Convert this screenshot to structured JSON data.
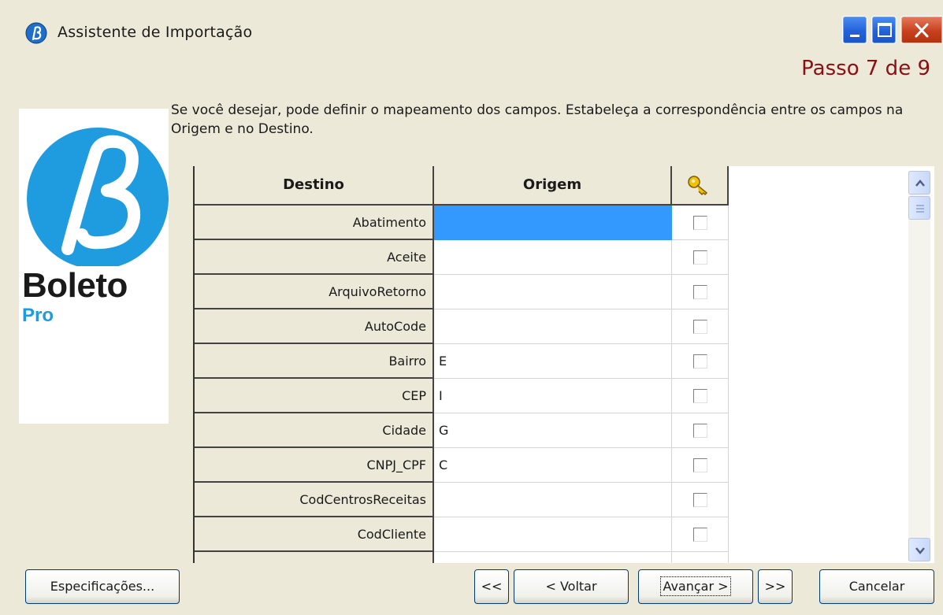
{
  "window": {
    "title": "Assistente de Importação",
    "step_label": "Passo 7 de 9",
    "description": "Se você desejar, pode definir o mapeamento dos campos. Estabeleça a correspondência entre os campos na Origem e no Destino."
  },
  "logo": {
    "word": "Boleto",
    "sub": "Pro",
    "accent_color": "#1f9ce0"
  },
  "grid": {
    "headers": {
      "destino": "Destino",
      "origem": "Origem",
      "key_icon": "key-icon"
    },
    "rows": [
      {
        "destino": "Abatimento",
        "origem": "",
        "checked": false,
        "selected": true
      },
      {
        "destino": "Aceite",
        "origem": "",
        "checked": false
      },
      {
        "destino": "ArquivoRetorno",
        "origem": "",
        "checked": false
      },
      {
        "destino": "AutoCode",
        "origem": "",
        "checked": false
      },
      {
        "destino": "Bairro",
        "origem": "E",
        "checked": false
      },
      {
        "destino": "CEP",
        "origem": "I",
        "checked": false
      },
      {
        "destino": "Cidade",
        "origem": "G",
        "checked": false
      },
      {
        "destino": "CNPJ_CPF",
        "origem": "C",
        "checked": false
      },
      {
        "destino": "CodCentrosReceitas",
        "origem": "",
        "checked": false
      },
      {
        "destino": "CodCliente",
        "origem": "",
        "checked": false
      }
    ],
    "selection_color": "#3399ff"
  },
  "buttons": {
    "specs": "Especificações...",
    "first": "<<",
    "back": "< Voltar",
    "next": "Avançar >",
    "last": ">>",
    "cancel": "Cancelar"
  }
}
